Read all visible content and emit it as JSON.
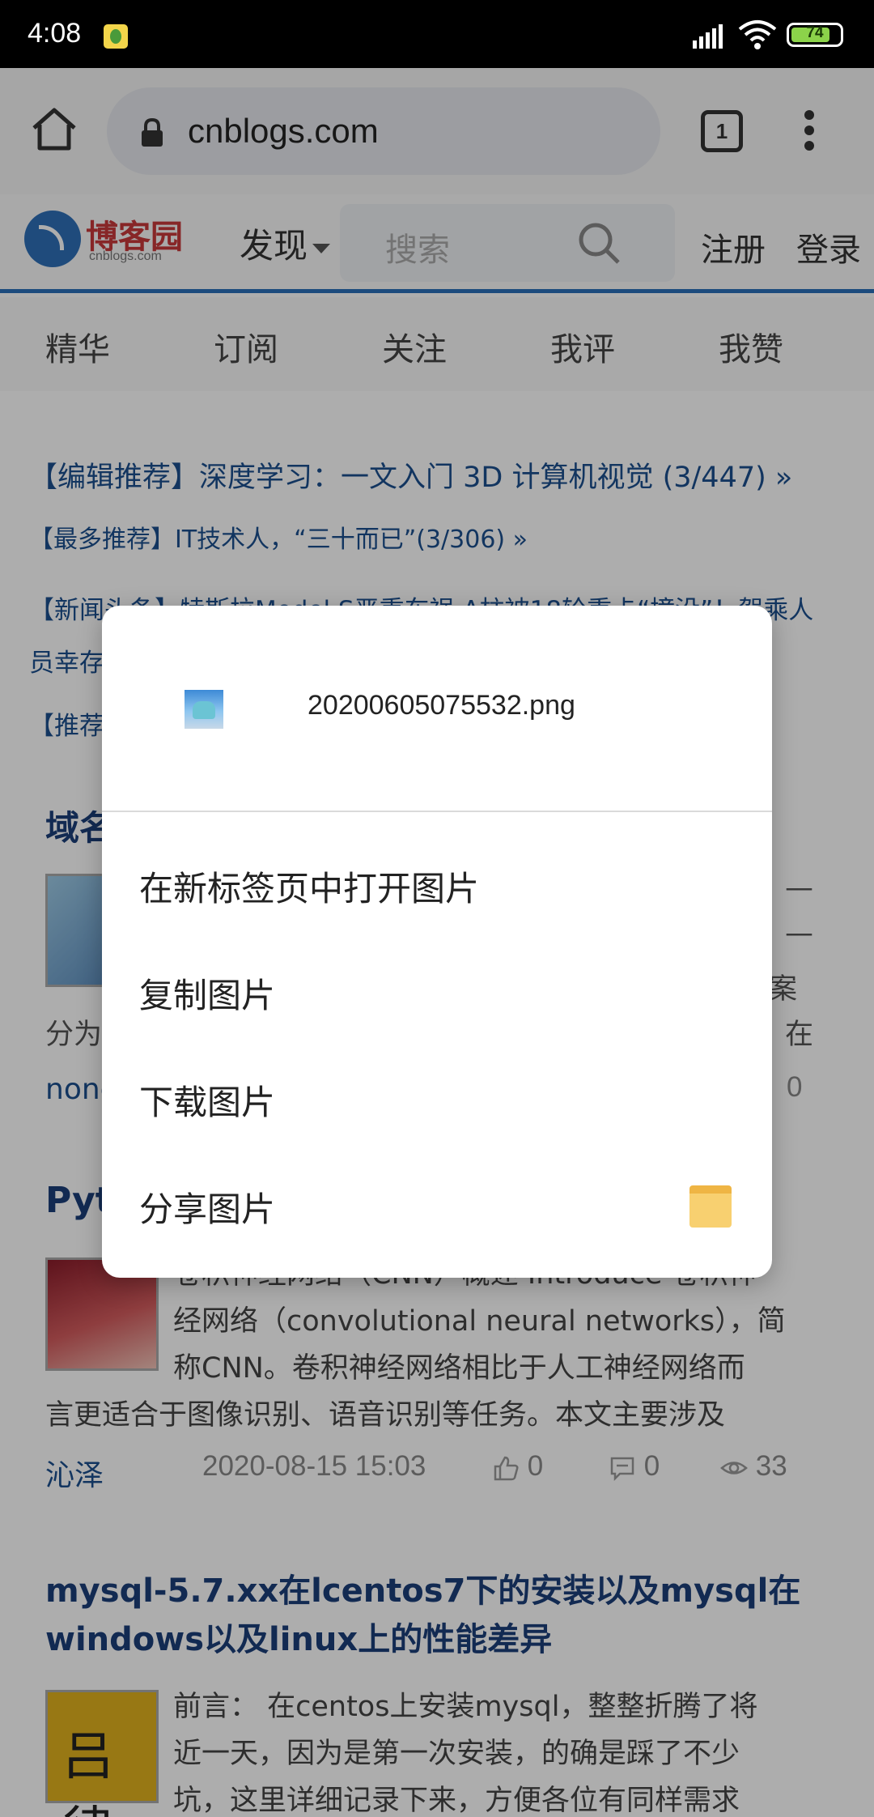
{
  "status_bar": {
    "time": "4:08",
    "battery": "74"
  },
  "browser": {
    "url": "cnblogs.com",
    "tab_count": "1"
  },
  "site_header": {
    "logo_cn": "博客园",
    "logo_en": "cnblogs.com",
    "discover": "发现",
    "search_placeholder": "搜索",
    "register": "注册",
    "login": "登录"
  },
  "tabs": [
    "精华",
    "订阅",
    "关注",
    "我评",
    "我赞"
  ],
  "recommendations": {
    "r1": "【编辑推荐】深度学习：一文入门 3D 计算机视觉 (3/447) »",
    "r2": "【最多推荐】IT技术人，“三十而已”(3/306) »",
    "r3_line1": "【新闻头条】特斯拉Model S严重车祸 A柱被18轮重卡“撞没”！驾乘人",
    "r3_line2": "员幸存",
    "r4": "【推荐"
  },
  "post1": {
    "title_fragment": "域名",
    "excerpt_right_1": "—",
    "excerpt_right_2": "—",
    "excerpt_right_3": "案",
    "excerpt_left_4": "分为",
    "excerpt_right_4": "在",
    "author_fragment": "none",
    "count_fragment": "0"
  },
  "post2": {
    "title_fragment": "Pyt",
    "excerpt_line1": "卷积神经网络（CNN）概述 Introduce 卷积神",
    "excerpt_line2": "经网络（convolutional neural networks），简",
    "excerpt_line3": "称CNN。卷积神经网络相比于人工神经网络而",
    "excerpt_line4": "言更适合于图像识别、语音识别等任务。本文主要涉及",
    "author": "沁泽",
    "date": "2020-08-15 15:03",
    "likes": "0",
    "comments": "0",
    "views": "33"
  },
  "post3": {
    "title": "mysql-5.7.xx在lcentos7下的安装以及mysql在windows以及linux上的性能差异",
    "thumb_text": "吕律",
    "excerpt_line1": "前言：  在centos上安装mysql，整整折腾了将",
    "excerpt_line2": "近一天，因为是第一次安装，的确是踩了不少",
    "excerpt_line3": "坑，这里详细记录下来，方便各位有同样需求"
  },
  "dialog": {
    "filename": "20200605075532.png",
    "items": [
      "在新标签页中打开图片",
      "复制图片",
      "下载图片",
      "分享图片"
    ]
  }
}
